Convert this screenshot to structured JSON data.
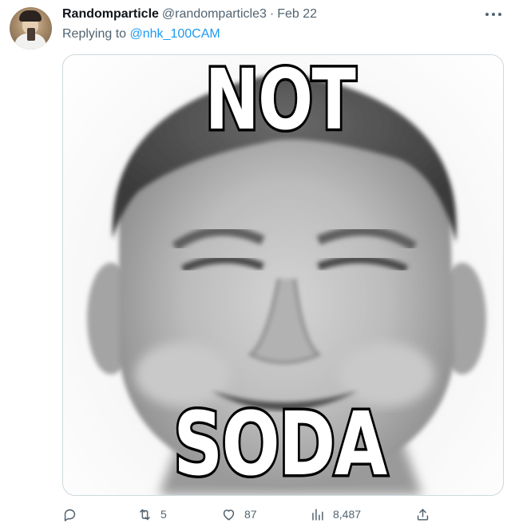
{
  "tweet": {
    "display_name": "Randomparticle",
    "handle": "@randomparticle3",
    "separator": "·",
    "date": "Feb 22",
    "replying_prefix": "Replying to",
    "replying_to": "@nhk_100CAM"
  },
  "media": {
    "top_text": "NOT",
    "bottom_text": "SODA"
  },
  "actions": {
    "reply_icon": "reply-icon",
    "retweet_icon": "retweet-icon",
    "retweet_count": "5",
    "like_icon": "heart-icon",
    "like_count": "87",
    "views_icon": "views-icon",
    "views_count": "8,487",
    "share_icon": "share-icon"
  },
  "colors": {
    "text_primary": "#0f1419",
    "text_secondary": "#536471",
    "link": "#1d9bf0",
    "border": "#cfd9de"
  }
}
